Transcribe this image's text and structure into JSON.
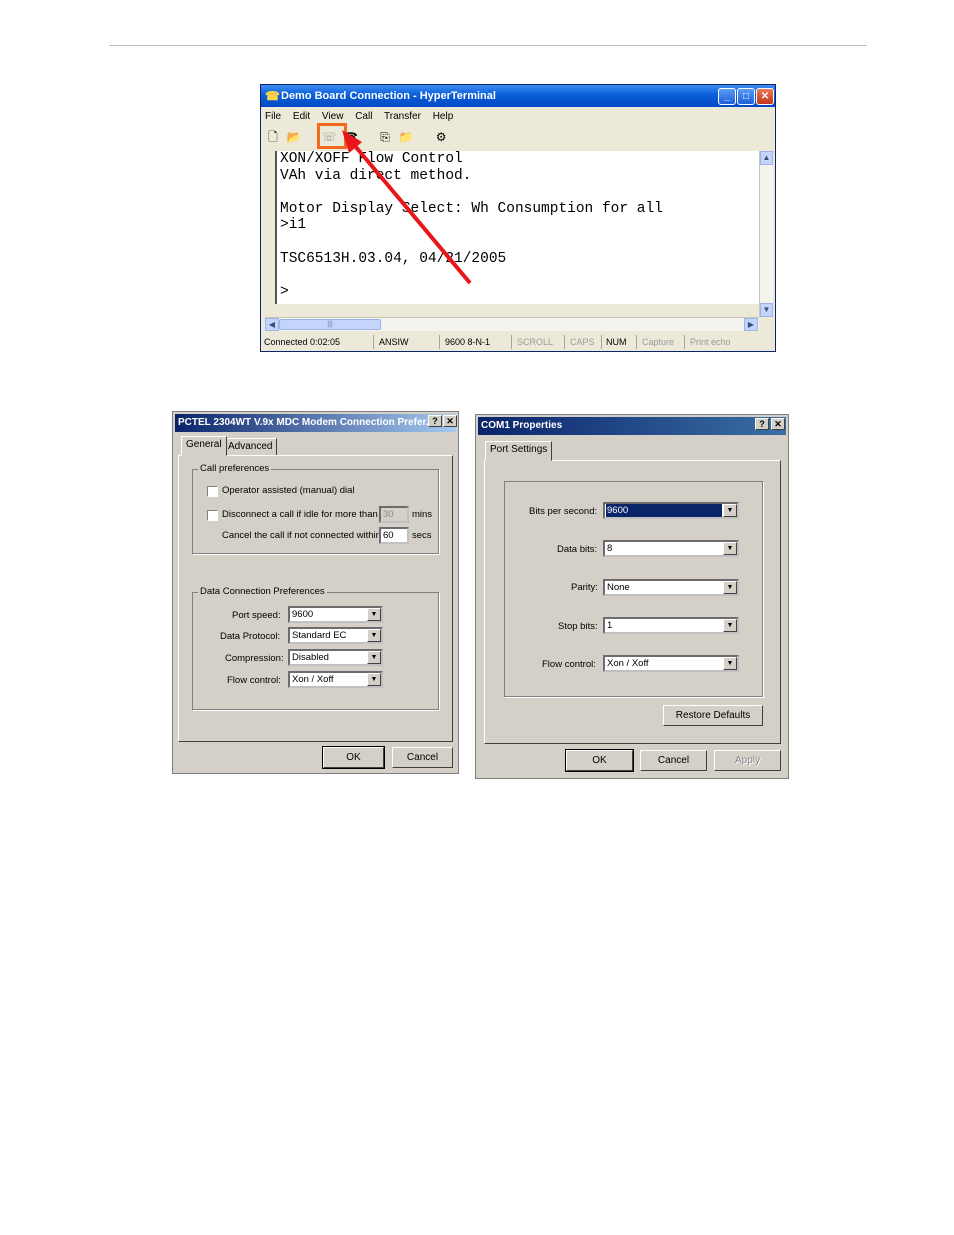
{
  "hyperterminal": {
    "title": "Demo Board Connection - HyperTerminal",
    "menu": [
      "File",
      "Edit",
      "View",
      "Call",
      "Transfer",
      "Help"
    ],
    "terminal_lines": [
      "XON/XOFF Flow Control",
      "VAh via direct method.",
      "",
      "Motor Display Select: Wh Consumption for all",
      ">i1",
      "",
      "TSC6513H.03.04, 04/21/2005",
      "",
      ">"
    ],
    "status": {
      "connected": "Connected 0:02:05",
      "emulation": "ANSIW",
      "port": "9600 8-N-1",
      "scroll": "SCROLL",
      "caps": "CAPS",
      "num": "NUM",
      "capture": "Capture",
      "print_echo": "Print echo"
    },
    "highlight_color": "#f26a1b",
    "arrow_color": "#e8151b"
  },
  "modem_dialog": {
    "title": "PCTEL 2304WT V.9x MDC Modem Connection Prefer...",
    "tabs": [
      "General",
      "Advanced"
    ],
    "call_prefs": {
      "group_label": "Call preferences",
      "operator_assisted": "Operator assisted (manual) dial",
      "disconnect_idle": "Disconnect a call if idle for more than",
      "idle_value": "30",
      "idle_unit": "mins",
      "cancel_call": "Cancel the call if not connected within",
      "cancel_value": "60",
      "cancel_unit": "secs"
    },
    "data_prefs": {
      "group_label": "Data Connection Preferences",
      "port_speed_label": "Port speed:",
      "port_speed": "9600",
      "protocol_label": "Data Protocol:",
      "protocol": "Standard EC",
      "compression_label": "Compression:",
      "compression": "Disabled",
      "flow_label": "Flow control:",
      "flow": "Xon / Xoff"
    },
    "ok": "OK",
    "cancel": "Cancel"
  },
  "com1_dialog": {
    "title": "COM1 Properties",
    "tab": "Port Settings",
    "bits_label": "Bits per second:",
    "bits": "9600",
    "data_bits_label": "Data bits:",
    "data_bits": "8",
    "parity_label": "Parity:",
    "parity": "None",
    "stop_bits_label": "Stop bits:",
    "stop_bits": "1",
    "flow_label": "Flow control:",
    "flow": "Xon / Xoff",
    "restore": "Restore Defaults",
    "ok": "OK",
    "cancel": "Cancel",
    "apply": "Apply"
  }
}
